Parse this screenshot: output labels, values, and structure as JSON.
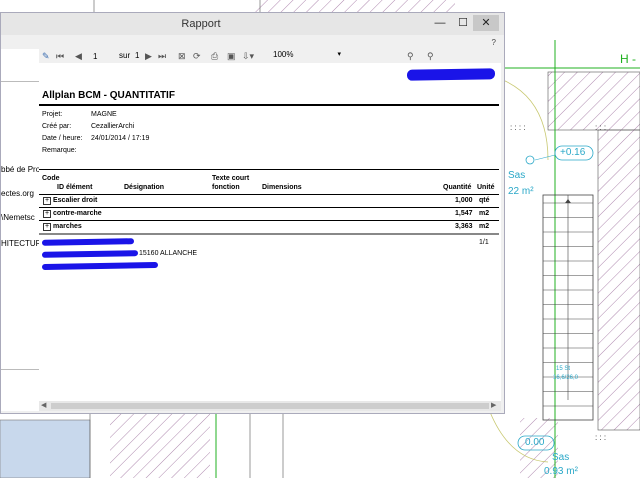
{
  "window": {
    "title": "Rapport",
    "minimize": "—",
    "maximize": "☐",
    "close": "✕",
    "help": "?"
  },
  "left_panel": {
    "items": [
      "bbé de Pro",
      "ectes.org",
      "\\Nemetsc",
      "HITECTUR"
    ]
  },
  "toolbar": {
    "page_value": "1",
    "of_label": "sur",
    "total_pages": "1",
    "zoom": "100%"
  },
  "report": {
    "title": "Allplan BCM - QUANTITATIF",
    "project_label": "Projet:",
    "project_value": "MAGNE",
    "created_by_label": "Créé par:",
    "created_by_value": "CezallierArchi",
    "date_label": "Date / heure:",
    "date_value": "24/01/2014  /  17:19",
    "remark_label": "Remarque:",
    "columns": {
      "code": "Code",
      "id": "ID élément",
      "designation": "Désignation",
      "texte_court": "Texte court",
      "fonction": "fonction",
      "dimensions": "Dimensions",
      "quantite": "Quantité",
      "unite": "Unité"
    },
    "rows": [
      {
        "name": "Escalier droit",
        "quantity": "1,000",
        "unit": "qté"
      },
      {
        "name": "contre-marche",
        "quantity": "1,547",
        "unit": "m2"
      },
      {
        "name": "marches",
        "quantity": "3,363",
        "unit": "m2"
      }
    ],
    "footer_address": "15160 ALLANCHE",
    "page_counter": "1/1"
  },
  "cad": {
    "label_h": "H -",
    "level_top": "+0.16",
    "room_top": "Sas",
    "area_top": "22 m²",
    "level_bottom": "0.00",
    "room_bottom": "Sas",
    "area_bottom": "0.93 m²",
    "stair_note": "15 St",
    "stair_dims": "16,6/26,0"
  },
  "colors": {
    "redaction": "#1a14e8",
    "cad_cyan": "#2aa8c8",
    "cad_green": "#20b020",
    "hatch": "#9a6a9a"
  }
}
